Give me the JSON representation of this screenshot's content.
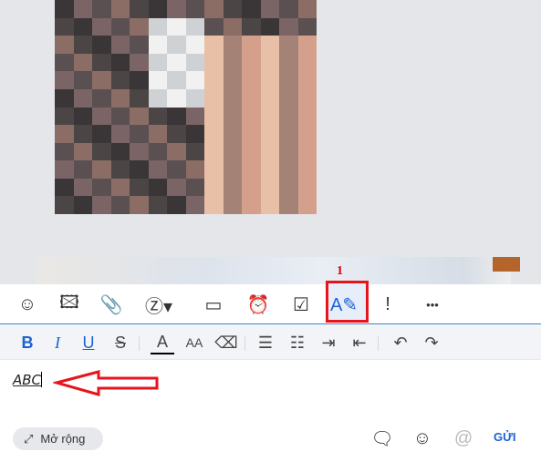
{
  "toolbar": {
    "items": [
      {
        "name": "sticker-icon",
        "glyph": "☺"
      },
      {
        "name": "image-icon",
        "glyph": "🖾"
      },
      {
        "name": "attachment-icon",
        "glyph": "📎"
      },
      {
        "name": "screenshot-icon",
        "glyph": "Ⓩ▾"
      },
      {
        "name": "contact-card-icon",
        "glyph": "▭"
      },
      {
        "name": "reminder-clock-icon",
        "glyph": "⏰"
      },
      {
        "name": "task-check-icon",
        "glyph": "☑"
      },
      {
        "name": "text-format-icon",
        "glyph": "A✎"
      },
      {
        "name": "important-icon",
        "glyph": "!"
      },
      {
        "name": "more-icon",
        "glyph": "•••"
      }
    ],
    "active": "text-format-icon",
    "accent": "#1a63d6"
  },
  "format": {
    "items": [
      {
        "name": "bold-icon",
        "glyph": "B"
      },
      {
        "name": "italic-icon",
        "glyph": "I"
      },
      {
        "name": "underline-icon",
        "glyph": "U"
      },
      {
        "name": "strikethrough-icon",
        "glyph": "S"
      },
      {
        "name": "text-color-icon",
        "glyph": "A"
      },
      {
        "name": "font-size-icon",
        "glyph": "AA"
      },
      {
        "name": "clear-format-icon",
        "glyph": "⌫"
      },
      {
        "name": "bullet-list-icon",
        "glyph": "☰"
      },
      {
        "name": "numbered-list-icon",
        "glyph": "☷"
      },
      {
        "name": "indent-icon",
        "glyph": "⇥"
      },
      {
        "name": "outdent-icon",
        "glyph": "⇤"
      },
      {
        "name": "undo-icon",
        "glyph": "↶"
      },
      {
        "name": "redo-icon",
        "glyph": "↷"
      }
    ]
  },
  "editor": {
    "text": "ABC"
  },
  "annotation": {
    "number": "1",
    "color": "#e8141c"
  },
  "footer": {
    "expand_label": "Mở rộng",
    "send_label": "GỬI"
  }
}
